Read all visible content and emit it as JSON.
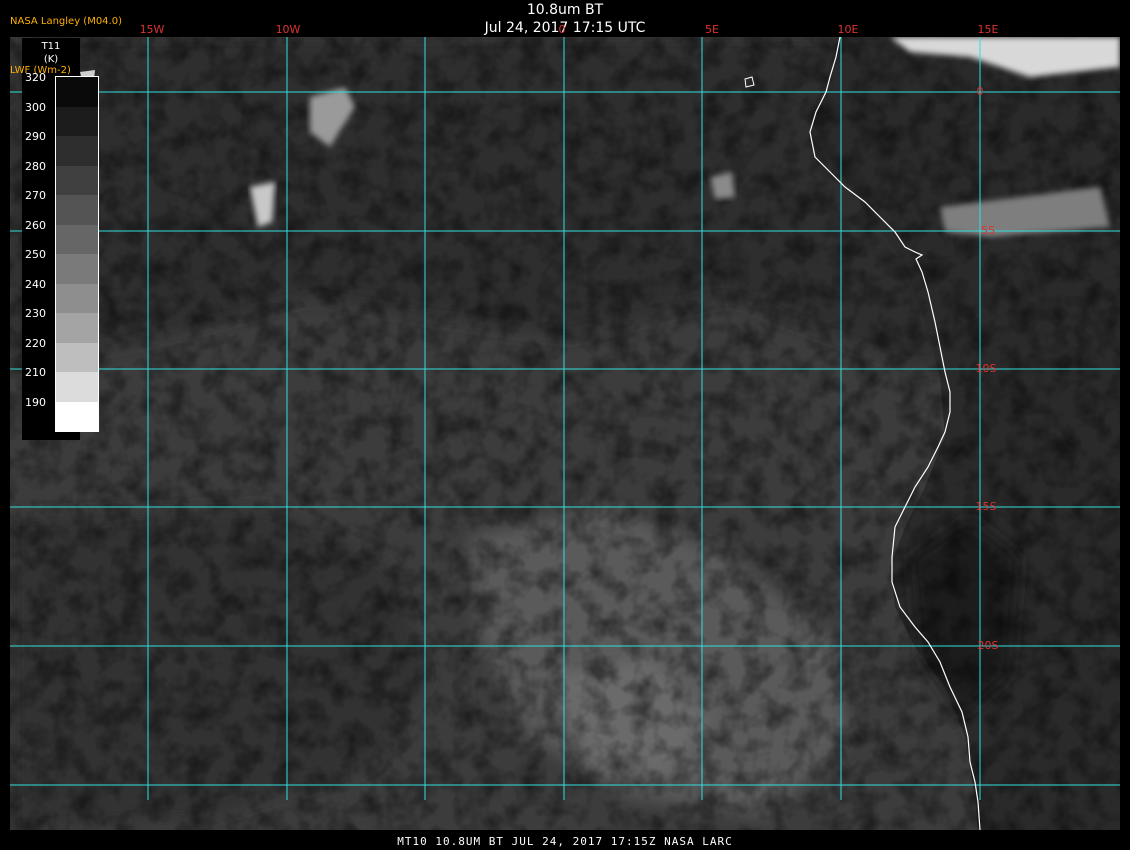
{
  "header": {
    "title": "10.8um BT",
    "datetime": "Jul 24, 2017 17:15 UTC",
    "credit": "NASA Langley (M04.0)"
  },
  "legend": {
    "title_line1": "T11",
    "title_line2": "(K)",
    "subtitle": "LWF (Wm-2)",
    "labels": [
      "320",
      "300",
      "290",
      "280",
      "270",
      "260",
      "250",
      "240",
      "230",
      "220",
      "210",
      "190"
    ],
    "colors": [
      "#0a0a0a",
      "#1c1c1c",
      "#2e2e2e",
      "#404040",
      "#545454",
      "#666666",
      "#7a7a7a",
      "#8e8e8e",
      "#a4a4a4",
      "#bebebe",
      "#dcdcdc",
      "#ffffff"
    ]
  },
  "map": {
    "longitude_labels": [
      "15W",
      "10W",
      "0",
      "5E",
      "10E",
      "15E"
    ],
    "latitude_labels": [
      "0",
      "5S",
      "10S",
      "15S",
      "20S"
    ],
    "grid_color": "#33dddd",
    "label_color": "#dd3333",
    "coastline_color": "#ffffff"
  },
  "footer": {
    "text": "MT10  10.8UM BT   JUL 24, 2017 17:15Z   NASA LARC"
  }
}
